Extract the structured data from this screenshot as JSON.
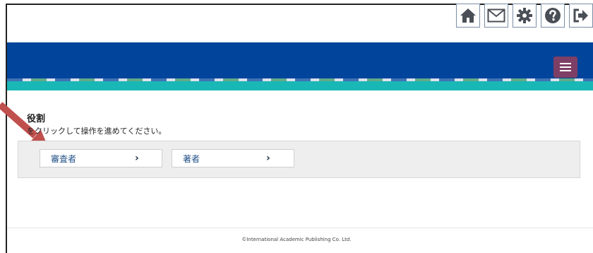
{
  "toolbar": {
    "items": [
      {
        "icon": "home-icon"
      },
      {
        "icon": "mail-icon"
      },
      {
        "icon": "gear-icon"
      },
      {
        "icon": "help-icon"
      },
      {
        "icon": "logout-icon"
      }
    ]
  },
  "colors": {
    "header_blue": "#00449b",
    "teal": "#19b7b5",
    "menu_button": "#7e3f66",
    "arrow": "#c0504d"
  },
  "roles": {
    "title": "役割",
    "description": "をクリックして操作を進めてください。",
    "buttons": [
      {
        "label": "審査者",
        "chevron": "›"
      },
      {
        "label": "著者",
        "chevron": "›"
      }
    ]
  },
  "footer": {
    "text": "©International Academic Publishing Co. Ltd."
  }
}
